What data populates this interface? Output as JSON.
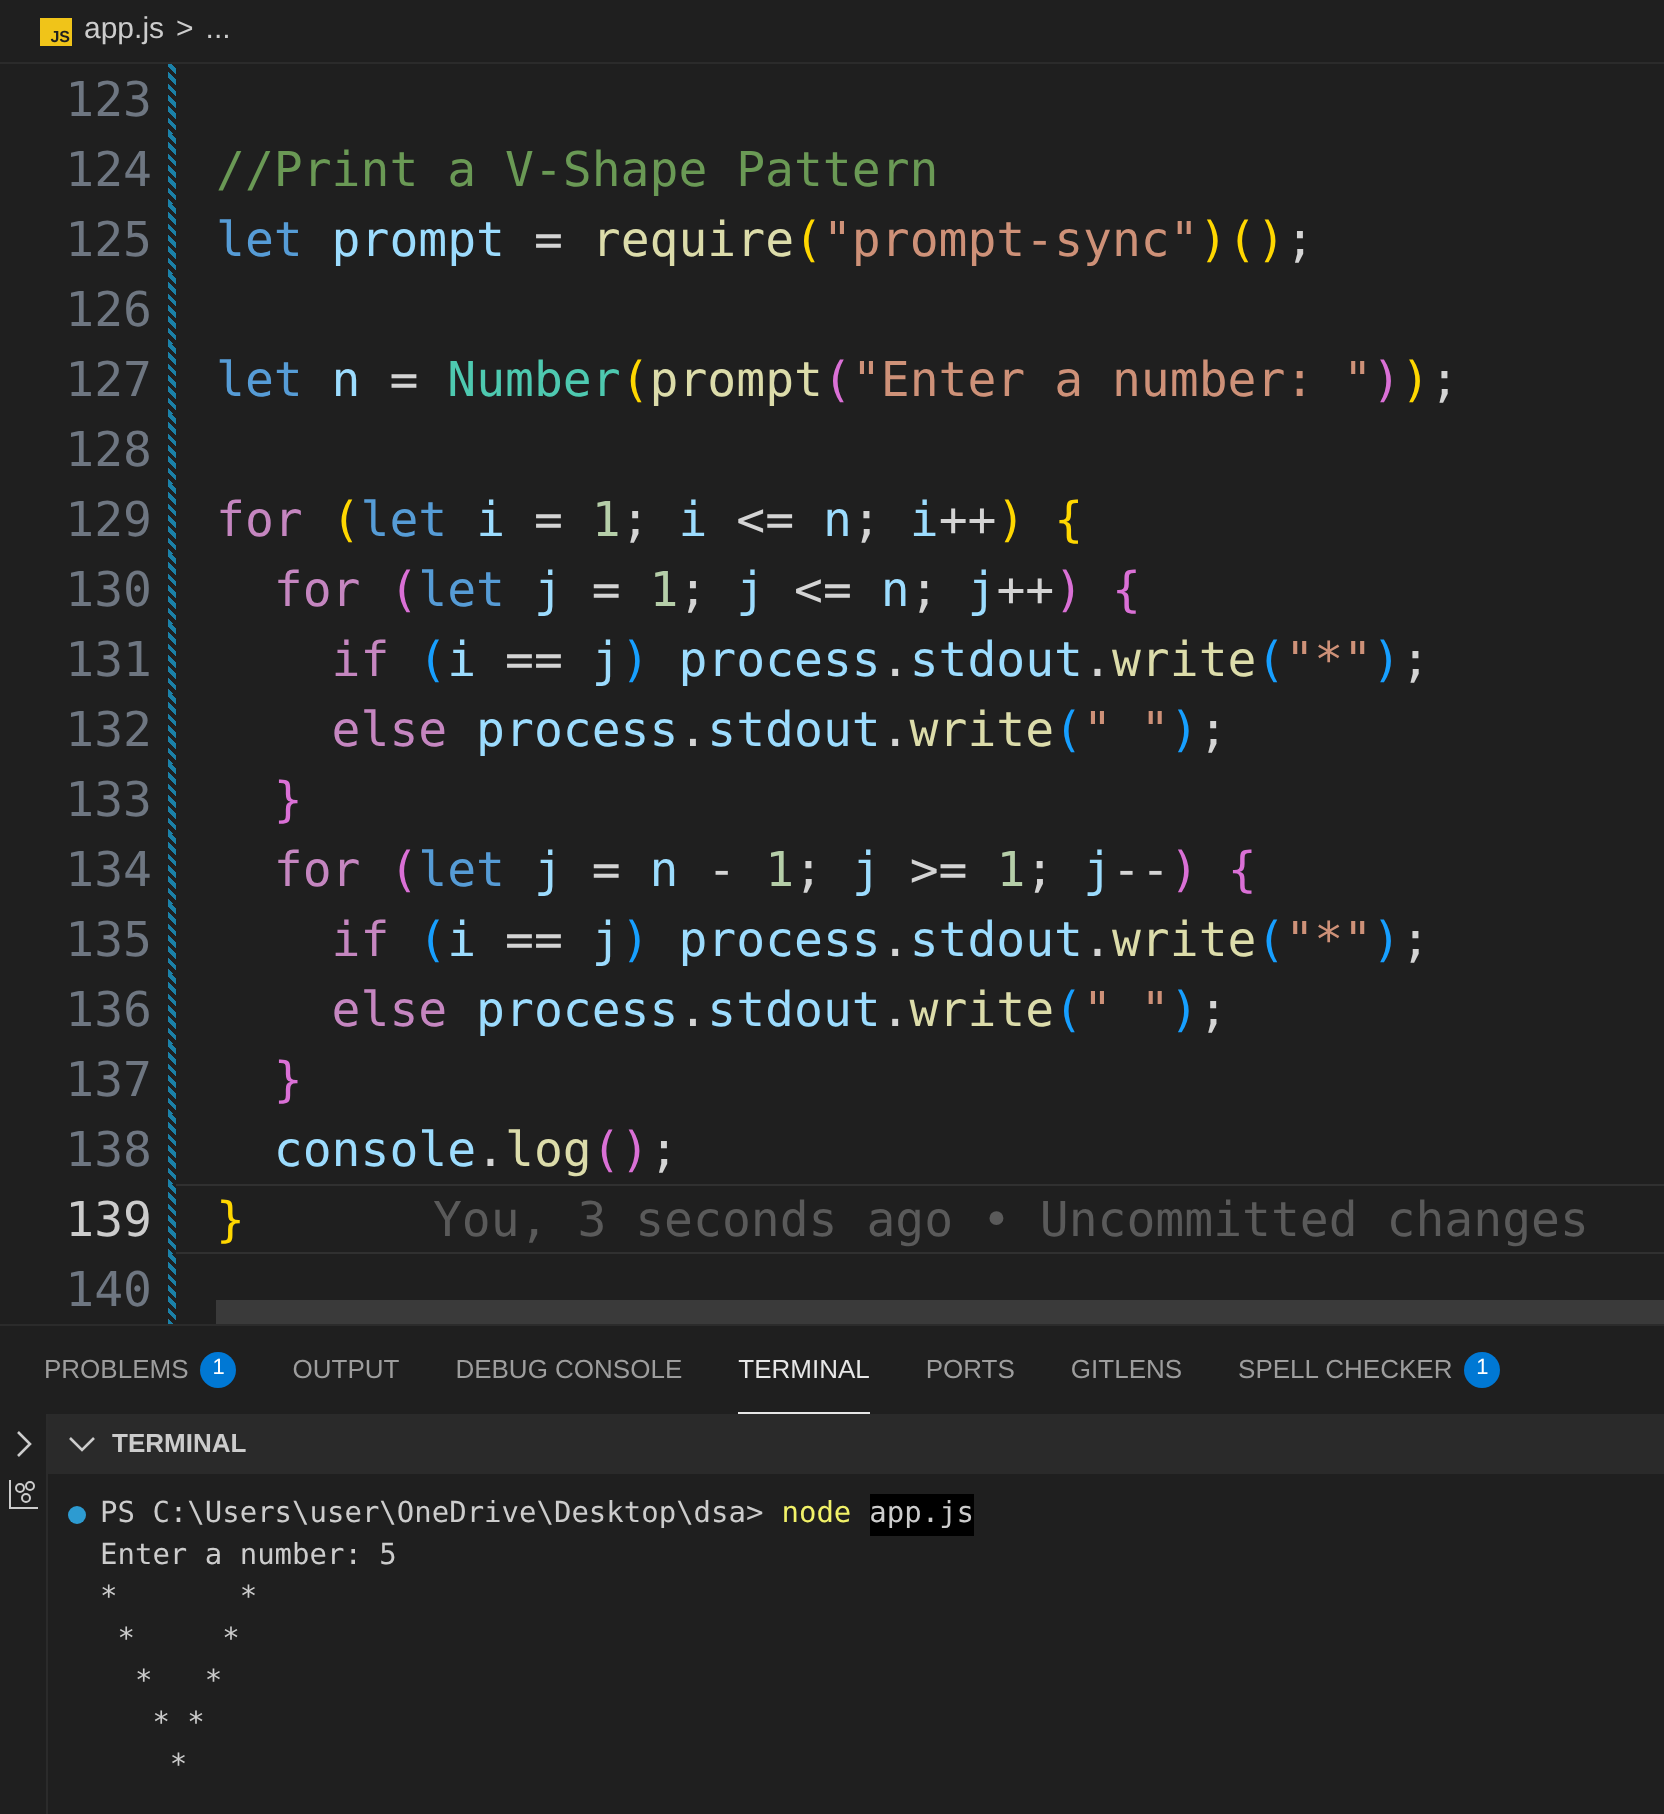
{
  "breadcrumb": {
    "file": "app.js",
    "file_badge": "JS",
    "separator": ">",
    "rest": "..."
  },
  "editor": {
    "lines": [
      {
        "number": "123",
        "current": false
      },
      {
        "number": "124",
        "current": false,
        "tokens": [
          {
            "text": "//Print a V-Shape Pattern",
            "kind": "comment"
          }
        ]
      },
      {
        "number": "125",
        "current": false,
        "tokens": [
          {
            "text": "let",
            "kind": "keyword"
          },
          {
            "text": " prompt",
            "kind": "variable"
          },
          {
            "text": " = ",
            "kind": "plain"
          },
          {
            "text": "require",
            "kind": "function"
          },
          {
            "text": "(",
            "kind": "bracket1"
          },
          {
            "text": "\"prompt-sync\"",
            "kind": "string"
          },
          {
            "text": ")()",
            "kind": "bracket1"
          },
          {
            "text": ";",
            "kind": "plain"
          }
        ]
      },
      {
        "number": "126",
        "current": false
      },
      {
        "number": "127",
        "current": false,
        "tokens": [
          {
            "text": "let",
            "kind": "keyword"
          },
          {
            "text": " n",
            "kind": "variable"
          },
          {
            "text": " = ",
            "kind": "plain"
          },
          {
            "text": "Number",
            "kind": "class"
          },
          {
            "text": "(",
            "kind": "bracket1"
          },
          {
            "text": "prompt",
            "kind": "function"
          },
          {
            "text": "(",
            "kind": "bracket2"
          },
          {
            "text": "\"Enter a number: \"",
            "kind": "string"
          },
          {
            "text": ")",
            "kind": "bracket2"
          },
          {
            "text": ")",
            "kind": "bracket1"
          },
          {
            "text": ";",
            "kind": "plain"
          }
        ]
      },
      {
        "number": "128",
        "current": false
      },
      {
        "number": "129",
        "current": false,
        "tokens": [
          {
            "text": "for",
            "kind": "control"
          },
          {
            "text": " (",
            "kind": "bracket1"
          },
          {
            "text": "let",
            "kind": "keyword"
          },
          {
            "text": " i",
            "kind": "variable"
          },
          {
            "text": " = ",
            "kind": "plain"
          },
          {
            "text": "1",
            "kind": "number"
          },
          {
            "text": "; ",
            "kind": "plain"
          },
          {
            "text": "i",
            "kind": "variable"
          },
          {
            "text": " <= ",
            "kind": "plain"
          },
          {
            "text": "n",
            "kind": "variable"
          },
          {
            "text": "; ",
            "kind": "plain"
          },
          {
            "text": "i",
            "kind": "variable"
          },
          {
            "text": "++",
            "kind": "plain"
          },
          {
            "text": ")",
            "kind": "bracket1"
          },
          {
            "text": " {",
            "kind": "bracket1"
          }
        ]
      },
      {
        "number": "130",
        "current": false,
        "tokens": [
          {
            "text": "  for",
            "kind": "control"
          },
          {
            "text": " (",
            "kind": "bracket2"
          },
          {
            "text": "let",
            "kind": "keyword"
          },
          {
            "text": " j",
            "kind": "variable"
          },
          {
            "text": " = ",
            "kind": "plain"
          },
          {
            "text": "1",
            "kind": "number"
          },
          {
            "text": "; ",
            "kind": "plain"
          },
          {
            "text": "j",
            "kind": "variable"
          },
          {
            "text": " <= ",
            "kind": "plain"
          },
          {
            "text": "n",
            "kind": "variable"
          },
          {
            "text": "; ",
            "kind": "plain"
          },
          {
            "text": "j",
            "kind": "variable"
          },
          {
            "text": "++",
            "kind": "plain"
          },
          {
            "text": ")",
            "kind": "bracket2"
          },
          {
            "text": " {",
            "kind": "bracket2"
          }
        ]
      },
      {
        "number": "131",
        "current": false,
        "tokens": [
          {
            "text": "    if",
            "kind": "control"
          },
          {
            "text": " (",
            "kind": "bracket3"
          },
          {
            "text": "i",
            "kind": "variable"
          },
          {
            "text": " == ",
            "kind": "plain"
          },
          {
            "text": "j",
            "kind": "variable"
          },
          {
            "text": ")",
            "kind": "bracket3"
          },
          {
            "text": " process",
            "kind": "variable"
          },
          {
            "text": ".",
            "kind": "plain"
          },
          {
            "text": "stdout",
            "kind": "variable"
          },
          {
            "text": ".",
            "kind": "plain"
          },
          {
            "text": "write",
            "kind": "function"
          },
          {
            "text": "(",
            "kind": "bracket3"
          },
          {
            "text": "\"*\"",
            "kind": "string"
          },
          {
            "text": ")",
            "kind": "bracket3"
          },
          {
            "text": ";",
            "kind": "plain"
          }
        ]
      },
      {
        "number": "132",
        "current": false,
        "tokens": [
          {
            "text": "    else",
            "kind": "control"
          },
          {
            "text": " process",
            "kind": "variable"
          },
          {
            "text": ".",
            "kind": "plain"
          },
          {
            "text": "stdout",
            "kind": "variable"
          },
          {
            "text": ".",
            "kind": "plain"
          },
          {
            "text": "write",
            "kind": "function"
          },
          {
            "text": "(",
            "kind": "bracket3"
          },
          {
            "text": "\" \"",
            "kind": "string"
          },
          {
            "text": ")",
            "kind": "bracket3"
          },
          {
            "text": ";",
            "kind": "plain"
          }
        ]
      },
      {
        "number": "133",
        "current": false,
        "tokens": [
          {
            "text": "  }",
            "kind": "bracket2"
          }
        ]
      },
      {
        "number": "134",
        "current": false,
        "tokens": [
          {
            "text": "  for",
            "kind": "control"
          },
          {
            "text": " (",
            "kind": "bracket2"
          },
          {
            "text": "let",
            "kind": "keyword"
          },
          {
            "text": " j",
            "kind": "variable"
          },
          {
            "text": " = ",
            "kind": "plain"
          },
          {
            "text": "n",
            "kind": "variable"
          },
          {
            "text": " - ",
            "kind": "plain"
          },
          {
            "text": "1",
            "kind": "number"
          },
          {
            "text": "; ",
            "kind": "plain"
          },
          {
            "text": "j",
            "kind": "variable"
          },
          {
            "text": " >= ",
            "kind": "plain"
          },
          {
            "text": "1",
            "kind": "number"
          },
          {
            "text": "; ",
            "kind": "plain"
          },
          {
            "text": "j",
            "kind": "variable"
          },
          {
            "text": "--",
            "kind": "plain"
          },
          {
            "text": ")",
            "kind": "bracket2"
          },
          {
            "text": " {",
            "kind": "bracket2"
          }
        ]
      },
      {
        "number": "135",
        "current": false,
        "tokens": [
          {
            "text": "    if",
            "kind": "control"
          },
          {
            "text": " (",
            "kind": "bracket3"
          },
          {
            "text": "i",
            "kind": "variable"
          },
          {
            "text": " == ",
            "kind": "plain"
          },
          {
            "text": "j",
            "kind": "variable"
          },
          {
            "text": ")",
            "kind": "bracket3"
          },
          {
            "text": " process",
            "kind": "variable"
          },
          {
            "text": ".",
            "kind": "plain"
          },
          {
            "text": "stdout",
            "kind": "variable"
          },
          {
            "text": ".",
            "kind": "plain"
          },
          {
            "text": "write",
            "kind": "function"
          },
          {
            "text": "(",
            "kind": "bracket3"
          },
          {
            "text": "\"*\"",
            "kind": "string"
          },
          {
            "text": ")",
            "kind": "bracket3"
          },
          {
            "text": ";",
            "kind": "plain"
          }
        ]
      },
      {
        "number": "136",
        "current": false,
        "tokens": [
          {
            "text": "    else",
            "kind": "control"
          },
          {
            "text": " process",
            "kind": "variable"
          },
          {
            "text": ".",
            "kind": "plain"
          },
          {
            "text": "stdout",
            "kind": "variable"
          },
          {
            "text": ".",
            "kind": "plain"
          },
          {
            "text": "write",
            "kind": "function"
          },
          {
            "text": "(",
            "kind": "bracket3"
          },
          {
            "text": "\" \"",
            "kind": "string"
          },
          {
            "text": ")",
            "kind": "bracket3"
          },
          {
            "text": ";",
            "kind": "plain"
          }
        ]
      },
      {
        "number": "137",
        "current": false,
        "tokens": [
          {
            "text": "  }",
            "kind": "bracket2"
          }
        ]
      },
      {
        "number": "138",
        "current": false,
        "tokens": [
          {
            "text": "  console",
            "kind": "variable"
          },
          {
            "text": ".",
            "kind": "plain"
          },
          {
            "text": "log",
            "kind": "function"
          },
          {
            "text": "()",
            "kind": "bracket2"
          },
          {
            "text": ";",
            "kind": "plain"
          }
        ]
      },
      {
        "number": "139",
        "current": true,
        "tokens": [
          {
            "text": "}",
            "kind": "bracket1"
          }
        ],
        "blame": "You, 3 seconds ago • Uncommitted changes"
      },
      {
        "number": "140",
        "current": false
      }
    ]
  },
  "panel_tabs": [
    {
      "label": "PROBLEMS",
      "badge": "1",
      "selected": false
    },
    {
      "label": "OUTPUT",
      "selected": false
    },
    {
      "label": "DEBUG CONSOLE",
      "selected": false
    },
    {
      "label": "TERMINAL",
      "selected": true
    },
    {
      "label": "PORTS",
      "selected": false
    },
    {
      "label": "GITLENS",
      "selected": false
    },
    {
      "label": "SPELL CHECKER",
      "badge": "1",
      "selected": false
    }
  ],
  "terminal": {
    "title": "TERMINAL",
    "lines": [
      {
        "kind": "prompt",
        "prompt": "PS C:\\Users\\user\\OneDrive\\Desktop\\dsa>",
        "command": "node",
        "args": "app.js"
      },
      {
        "kind": "output",
        "text": "Enter a number: 5"
      },
      {
        "kind": "output",
        "text": "*       *"
      },
      {
        "kind": "output",
        "text": " *     *"
      },
      {
        "kind": "output",
        "text": "  *   *"
      },
      {
        "kind": "output",
        "text": "   * *"
      },
      {
        "kind": "output",
        "text": "    *"
      }
    ]
  }
}
